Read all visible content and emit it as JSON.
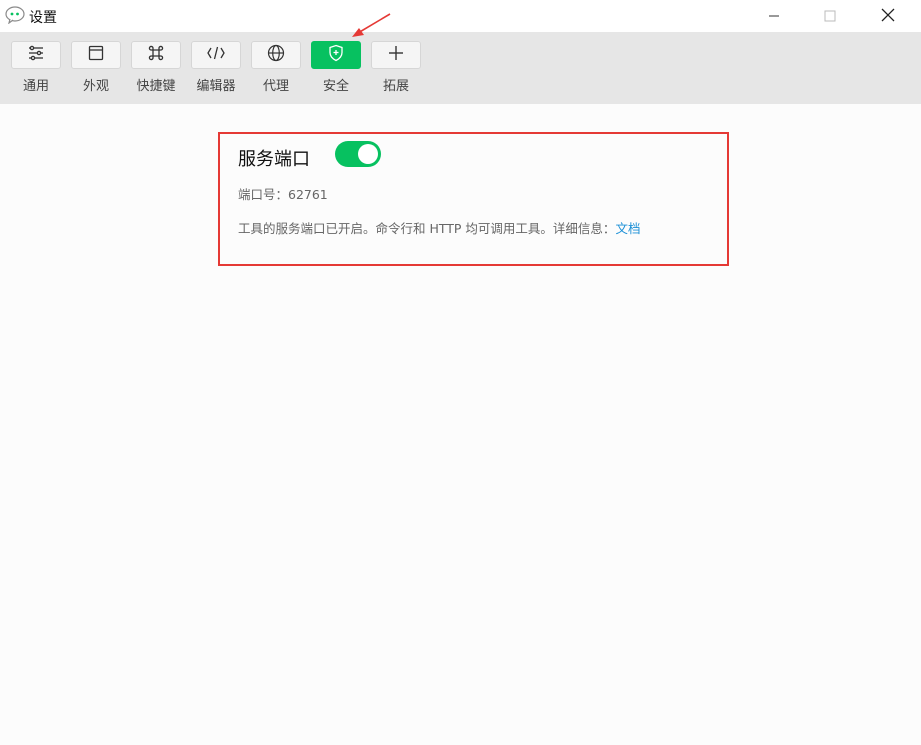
{
  "window": {
    "title": "设置",
    "controls": {
      "minimize_icon": "minimize-icon",
      "maximize_icon": "maximize-icon",
      "close_icon": "close-icon"
    }
  },
  "toolbar": {
    "items": [
      {
        "label": "通用",
        "icon": "sliders-icon",
        "active": false
      },
      {
        "label": "外观",
        "icon": "window-icon",
        "active": false
      },
      {
        "label": "快捷键",
        "icon": "command-icon",
        "active": false
      },
      {
        "label": "编辑器",
        "icon": "code-icon",
        "active": false
      },
      {
        "label": "代理",
        "icon": "globe-icon",
        "active": false
      },
      {
        "label": "安全",
        "icon": "shield-icon",
        "active": true
      },
      {
        "label": "拓展",
        "icon": "plus-icon",
        "active": false
      }
    ]
  },
  "service_port": {
    "title": "服务端口",
    "toggle_on": true,
    "port_label": "端口号：62761",
    "description": "工具的服务端口已开启。命令行和 HTTP 均可调用工具。详细信息：",
    "doc_link": "文档"
  },
  "colors": {
    "accent": "#07c160",
    "annotation": "#e53935",
    "link": "#1a8fd6",
    "toolbar_bg": "#e6e6e6"
  }
}
